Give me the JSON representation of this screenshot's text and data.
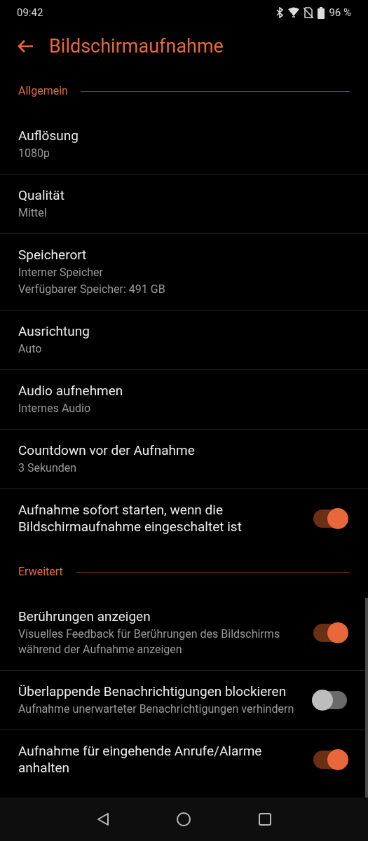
{
  "status_bar": {
    "time": "09:42",
    "battery": "96 %"
  },
  "header": {
    "title": "Bildschirmaufnahme"
  },
  "sections": [
    {
      "title": "Allgemein",
      "items": [
        {
          "kind": "value",
          "title": "Auflösung",
          "summary": [
            "1080p"
          ]
        },
        {
          "kind": "value",
          "title": "Qualität",
          "summary": [
            "Mittel"
          ]
        },
        {
          "kind": "value",
          "title": "Speicherort",
          "summary": [
            "Interner Speicher",
            "Verfügbarer Speicher: 491 GB"
          ]
        },
        {
          "kind": "value",
          "title": "Ausrichtung",
          "summary": [
            "Auto"
          ]
        },
        {
          "kind": "value",
          "title": "Audio aufnehmen",
          "summary": [
            "Internes Audio"
          ]
        },
        {
          "kind": "value",
          "title": "Countdown vor der Aufnahme",
          "summary": [
            "3 Sekunden"
          ]
        },
        {
          "kind": "toggle",
          "title": "Aufnahme sofort starten, wenn die Bildschirmaufnahme eingeschaltet ist",
          "on": true
        }
      ]
    },
    {
      "title": "Erweitert",
      "items": [
        {
          "kind": "toggle",
          "title": "Berührungen anzeigen",
          "summary": [
            "Visuelles Feedback für Berührungen des Bildschirms während der Aufnahme anzeigen"
          ],
          "on": true
        },
        {
          "kind": "toggle",
          "title": "Überlappende Benachrichtigungen blockieren",
          "summary": [
            "Aufnahme unerwarteter Benachrichtigungen verhindern"
          ],
          "on": false
        },
        {
          "kind": "toggle",
          "title": "Aufnahme für eingehende Anrufe/Alarme anhalten",
          "on": true
        }
      ]
    }
  ]
}
